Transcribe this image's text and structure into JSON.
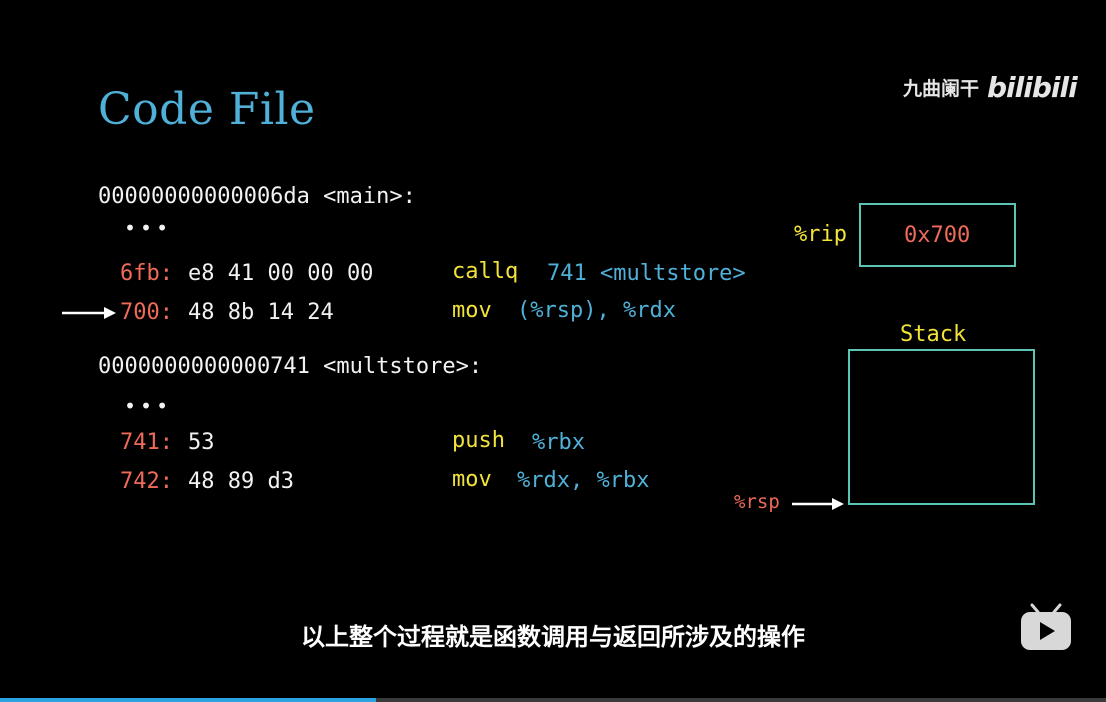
{
  "title": "Code File",
  "watermark": {
    "text": "九曲阑干",
    "logo": "bilibili"
  },
  "code": {
    "main_header": "00000000000006da <main>:",
    "main_dots": "•••",
    "main_lines": [
      {
        "addr": "6fb:",
        "bytes": "e8 41 00 00 00",
        "op": "callq",
        "args": "741 <multstore>"
      },
      {
        "addr": "700:",
        "bytes": "48 8b 14 24",
        "op": "mov",
        "args": "(%rsp), %rdx"
      }
    ],
    "multstore_header": "0000000000000741 <multstore>:",
    "multstore_dots": "•••",
    "multstore_lines": [
      {
        "addr": "741:",
        "bytes": "53",
        "op": "push",
        "args": "%rbx"
      },
      {
        "addr": "742:",
        "bytes": "48 89 d3",
        "op": "mov",
        "args": "%rdx, %rbx"
      }
    ]
  },
  "registers": {
    "rip_label": "%rip",
    "rip_value": "0x700",
    "stack_label": "Stack",
    "rsp_label": "%rsp"
  },
  "subtitle": "以上整个过程就是函数调用与返回所涉及的操作",
  "progress": {
    "fraction": 0.34,
    "color": "#2aa3e0"
  }
}
